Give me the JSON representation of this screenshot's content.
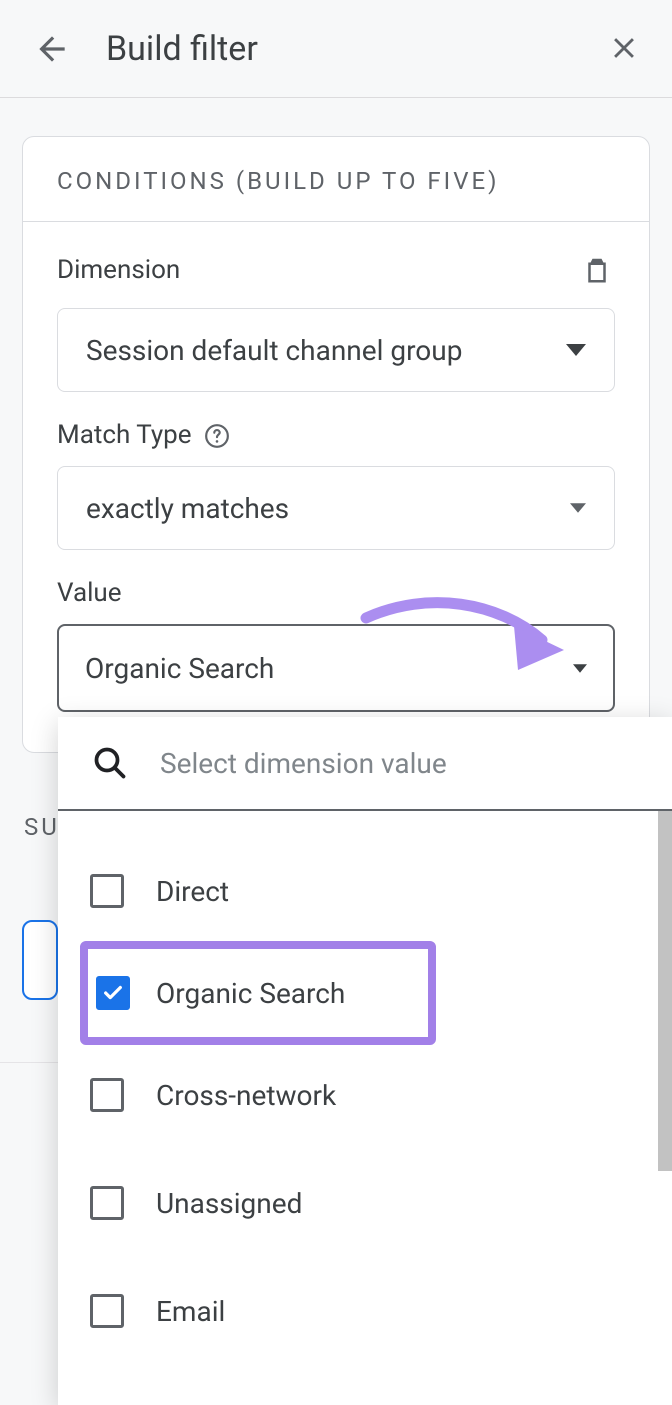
{
  "header": {
    "title": "Build filter"
  },
  "card": {
    "section_label": "Conditions (build up to five)",
    "dimension_label": "Dimension",
    "dimension_value": "Session default channel group",
    "match_type_label": "Match Type",
    "match_type_value": "exactly matches",
    "value_label": "Value",
    "value_value": "Organic Search"
  },
  "summary_label_fragment": "SU",
  "dropdown": {
    "search_placeholder": "Select dimension value",
    "options": [
      {
        "label": "Direct",
        "checked": false,
        "highlight": false
      },
      {
        "label": "Organic Search",
        "checked": true,
        "highlight": true
      },
      {
        "label": "Cross-network",
        "checked": false,
        "highlight": false
      },
      {
        "label": "Unassigned",
        "checked": false,
        "highlight": false
      },
      {
        "label": "Email",
        "checked": false,
        "highlight": false
      }
    ]
  }
}
